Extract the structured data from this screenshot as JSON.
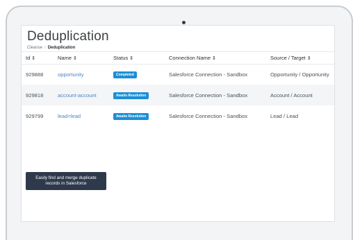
{
  "page": {
    "title": "Deduplication",
    "breadcrumb": {
      "parent": "Cleanse",
      "separator": "/",
      "current": "Deduplication"
    }
  },
  "table": {
    "columns": [
      "Id",
      "Name",
      "Status",
      "Connection Name",
      "Source / Target"
    ],
    "sort_icon": "⇕",
    "rows": [
      {
        "id": "929888",
        "name": "opportunity",
        "status": "Completed",
        "connection": "Salesforce Connection - Sandbox",
        "source_target": "Opportunity / Opportunity"
      },
      {
        "id": "929818",
        "name": "account-account",
        "status": "Awaits Resolution",
        "connection": "Salesforce Connection - Sandbox",
        "source_target": "Account / Account"
      },
      {
        "id": "929799",
        "name": "lead=lead",
        "status": "Awaits Resolution",
        "connection": "Salesforce Connection - Sandbox",
        "source_target": "Lead / Lead"
      }
    ]
  },
  "tooltip": {
    "line1": "Easily find and merge duplicate",
    "line2": "records in Salesforce"
  },
  "colors": {
    "badge": "#1b8fd6",
    "link": "#4a86c8",
    "tooltip_bg": "#2e3a4c"
  },
  "icons": {
    "sort": "sort-icon",
    "camera": "camera-icon"
  }
}
